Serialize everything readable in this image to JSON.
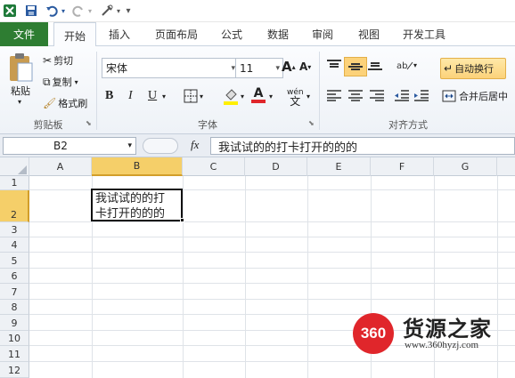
{
  "qat": {
    "redo_hint": "",
    "separator": "|"
  },
  "tabs": [
    "文件",
    "开始",
    "插入",
    "页面布局",
    "公式",
    "数据",
    "审阅",
    "视图",
    "开发工具"
  ],
  "clipboard": {
    "paste": "粘贴",
    "cut": "剪切",
    "copy": "复制",
    "format_painter": "格式刷",
    "group": "剪贴板"
  },
  "font": {
    "name": "宋体",
    "size": "11",
    "bold": "B",
    "italic": "I",
    "underline": "U",
    "grow": "A",
    "shrink": "A",
    "color_letter": "A",
    "pinyin": "wén",
    "group": "字体"
  },
  "alignment": {
    "wrap_text": "自动换行",
    "merge_center": "合并后居中",
    "group": "对齐方式"
  },
  "formula_bar": {
    "name_box": "B2",
    "fx": "fx",
    "content": "我试试的的打卡打开的的的"
  },
  "columns": [
    "A",
    "B",
    "C",
    "D",
    "E",
    "F",
    "G"
  ],
  "rows": [
    "1",
    "2",
    "3",
    "4",
    "5",
    "6",
    "7",
    "8",
    "9",
    "10",
    "11",
    "12"
  ],
  "cell_b2": "我试试的的打卡打开的的的",
  "watermark": {
    "badge": "360",
    "brand": "货源之家",
    "url": "www.360hyzj.com"
  },
  "colors": {
    "file_tab": "#2e7d32",
    "selected_col": "#f5cf69",
    "wrap_btn": "#fcd27a",
    "badge": "#e0262b"
  }
}
